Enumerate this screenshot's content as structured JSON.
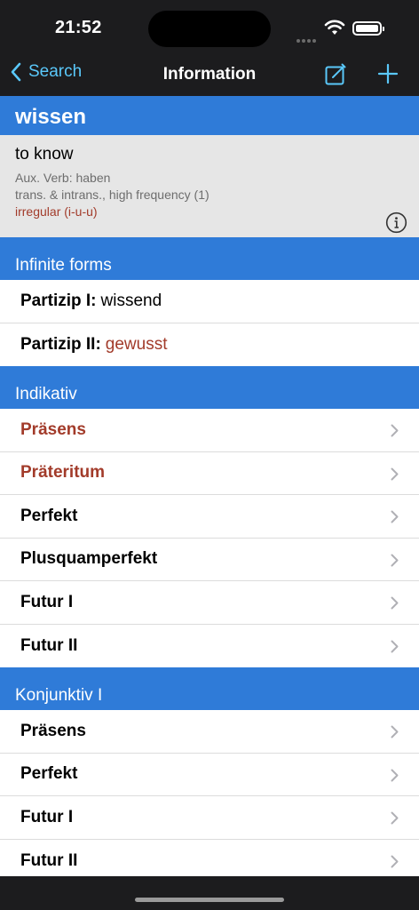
{
  "status": {
    "time": "21:52"
  },
  "nav": {
    "back_label": "Search",
    "title": "Information"
  },
  "verb": {
    "word": "wissen",
    "translation": "to know",
    "aux": "Aux. Verb: haben",
    "usage": "trans. & intrans., high frequency (1)",
    "irregular": "irregular (i-u-u)"
  },
  "sections": {
    "infinite": {
      "title": "Infinite forms",
      "partizip1_label": "Partizip I:",
      "partizip1_value": "wissend",
      "partizip2_label": "Partizip II:",
      "partizip2_value": "gewusst"
    },
    "indikativ": {
      "title": "Indikativ",
      "items": [
        "Präsens",
        "Präteritum",
        "Perfekt",
        "Plusquamperfekt",
        "Futur I",
        "Futur II"
      ]
    },
    "konjunktiv1": {
      "title": "Konjunktiv I",
      "items": [
        "Präsens",
        "Perfekt",
        "Futur I",
        "Futur II"
      ]
    }
  },
  "colors": {
    "accent": "#2f7bd8",
    "tint": "#5ac8fa",
    "irregular": "#a23b2a"
  },
  "icons": [
    "chevron-left-icon",
    "compose-icon",
    "plus-icon",
    "info-icon",
    "chevron-right-icon",
    "wifi-icon",
    "battery-icon"
  ]
}
